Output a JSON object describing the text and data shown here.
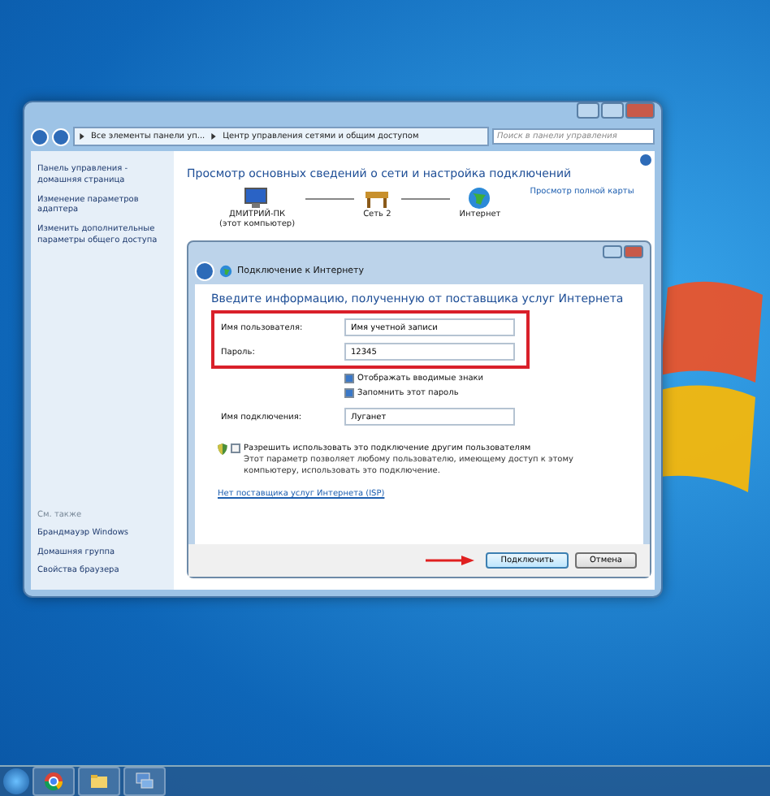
{
  "window": {
    "address": [
      "Все элементы панели уп...",
      "Центр управления сетями и общим доступом"
    ],
    "search": {
      "placeholder": "Поиск в панели управления"
    }
  },
  "sidebar": {
    "links": [
      "Панель управления - домашняя страница",
      "Изменение параметров адаптера",
      "Изменить дополнительные параметры общего доступа"
    ],
    "see_also_title": "См. также",
    "see_also": [
      "Брандмауэр Windows",
      "Домашняя группа",
      "Свойства браузера"
    ]
  },
  "main": {
    "heading": "Просмотр основных сведений о сети и настройка подключений",
    "map_link": "Просмотр полной карты",
    "nodes": [
      {
        "kind": "computer",
        "name": "ДМИТРИЙ-ПК",
        "sub": "(этот компьютер)"
      },
      {
        "kind": "network",
        "name": "Сеть 2"
      },
      {
        "kind": "globe",
        "name": "Интернет"
      }
    ]
  },
  "dialog": {
    "title": "Подключение к Интернету",
    "heading": "Введите информацию, полученную от поставщика услуг Интернета",
    "fields": [
      {
        "label": "Имя пользователя:",
        "value": "Имя учетной записи"
      },
      {
        "label": "Пароль:",
        "value": "12345"
      }
    ],
    "checks": [
      {
        "label": "Отображать вводимые знаки",
        "checked": true
      },
      {
        "label": "Запомнить этот пароль",
        "checked": true
      }
    ],
    "connection": {
      "label": "Имя подключения:",
      "value": "Луганет"
    },
    "allow": {
      "label": "Разрешить использовать это подключение другим пользователям",
      "checked": false,
      "note": "Этот параметр позволяет любому пользователю, имеющему доступ к этому компьютеру, использовать это подключение."
    },
    "isp_link": "Нет поставщика услуг Интернета (ISP)",
    "buttons": [
      {
        "label": "Подключить",
        "default": true
      },
      {
        "label": "Отмена",
        "default": false
      }
    ]
  }
}
